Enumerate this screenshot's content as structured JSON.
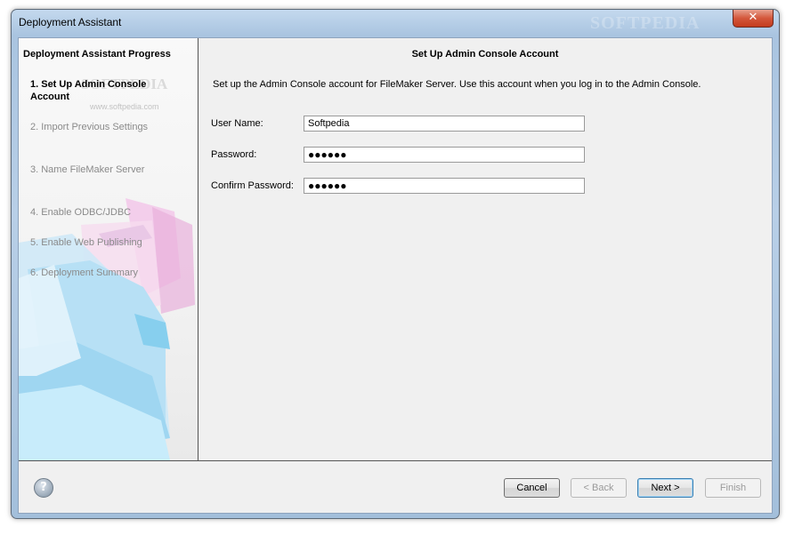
{
  "window": {
    "title": "Deployment Assistant",
    "close_label": "✕",
    "watermark": "SOFTPEDIA"
  },
  "left_panel": {
    "title": "Deployment Assistant Progress",
    "watermark": "SOFTPEDIA",
    "watermark_url": "www.softpedia.com",
    "steps": [
      {
        "label": "1. Set Up Admin Console Account",
        "active": true
      },
      {
        "label": "2. Import Previous Settings",
        "active": false
      },
      {
        "label": "3. Name FileMaker Server",
        "active": false
      },
      {
        "label": "4. Enable ODBC/JDBC",
        "active": false
      },
      {
        "label": "5. Enable Web Publishing",
        "active": false
      },
      {
        "label": "6. Deployment Summary",
        "active": false
      }
    ]
  },
  "main": {
    "heading": "Set Up Admin Console Account",
    "intro": "Set up the Admin Console account for FileMaker Server. Use this account when you log in to the Admin Console.",
    "fields": [
      {
        "label": "User Name:",
        "value": "Softpedia"
      },
      {
        "label": "Password:",
        "value": "●●●●●●"
      },
      {
        "label": "Confirm Password:",
        "value": "●●●●●●"
      }
    ]
  },
  "footer": {
    "help_label": "?",
    "cancel_label": "Cancel",
    "back_label": "< Back",
    "next_label": "Next >",
    "finish_label": "Finish"
  },
  "colors": {
    "frame": "#a9c4e0",
    "close": "#c33b1d",
    "panel": "#f0f0f0",
    "default_button_border": "#3c7fb1"
  }
}
